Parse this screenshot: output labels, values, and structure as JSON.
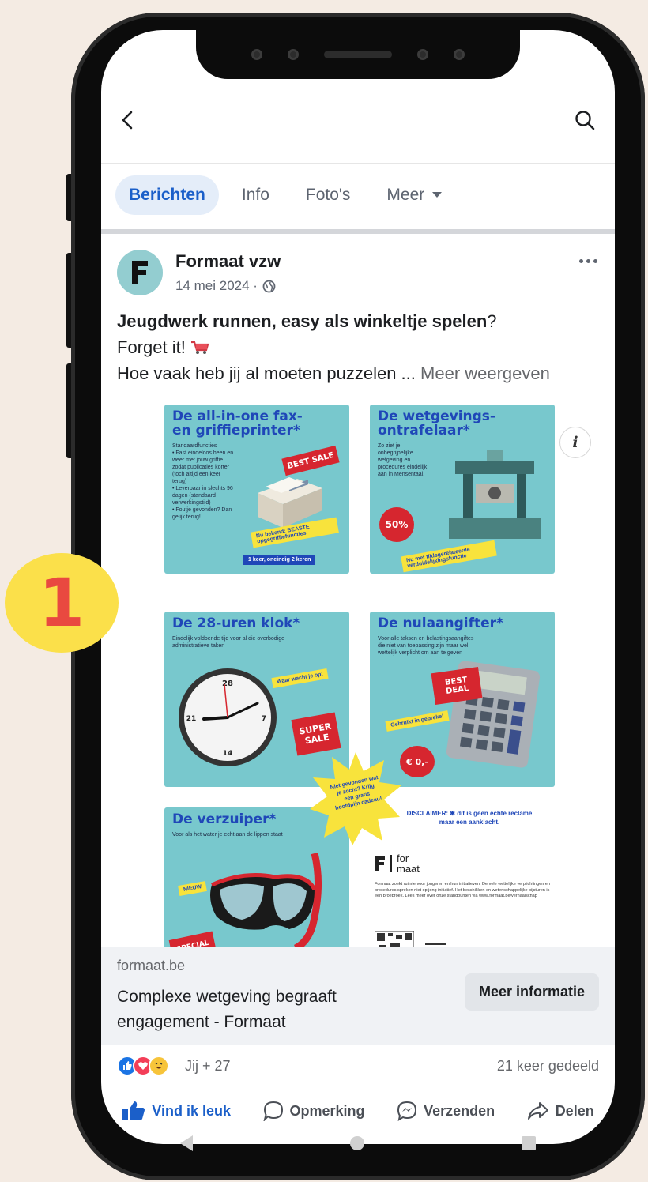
{
  "step_badge": "1",
  "tabs": [
    {
      "label": "Berichten"
    },
    {
      "label": "Info"
    },
    {
      "label": "Foto's"
    },
    {
      "label": "Meer"
    }
  ],
  "post": {
    "author": "Formaat vzw",
    "date": "14 mei 2024 ·",
    "text_line1_bold": "Jeugdwerk runnen, easy als winkeltje spelen",
    "text_line1_end": "?",
    "text_line2": "Forget it!",
    "text_line3": "Hoe vaak heb jij al moeten puzzelen ...",
    "see_more": "Meer weergeven"
  },
  "image": {
    "info_glyph": "i",
    "cards": [
      {
        "title": "De all-in-one fax-\nen griffieprinter*",
        "body": "Standaardfuncties\n• Fast eindeloos heen en weer met jouw griffie zodat publicaties korter (toch altijd een keer terug)\n• Leverbaar in slechts 96 dagen (standaard verwerkingstijd)\n• Foutje gevonden? Dan gelijk terug!",
        "tag1": "BEST SALE",
        "tag2": "Nu bekend: BEASTE opgegriffiefuncties",
        "tag3": "1 keer, oneindig 2 keren"
      },
      {
        "title": "De wetgevings-\nontrafelaar*",
        "body": "Zo ziet je onbegrijpelijke wetgeving en procedures eindelijk aan in Mensentaal.",
        "tag1": "50%",
        "tag2": "Nu met tijdsgerelateerde verduidelijkingsfunctie"
      },
      {
        "title": "De 28-uren klok*",
        "body": "Eindelijk voldoende tijd voor al die overbodige administratieve taken",
        "tag1": "Waar wacht je op!",
        "tag2": "SUPER SALE"
      },
      {
        "title": "De nulaangifter*",
        "body": "Voor alle taksen en belastingsaangiftes die niet van toepassing zijn maar wel wettelijk verplicht om aan te geven",
        "tag1": "BEST DEAL",
        "tag2": "Gebruikt in gebreke!",
        "tag3": "€ 0,-"
      },
      {
        "title": "De verzuiper*",
        "body": "Voor als het water je echt aan de lippen staat",
        "tag1": "NIEUW",
        "tag2": "SPECIAL"
      }
    ],
    "burst_text": "Niet gevonden wat je zocht? Krijg een gratis hoofdpijn cadeau!",
    "disclaimer": "DISCLAIMER: ✱ dit is geen echte reclame maar een aanklacht.",
    "logo_for": "for",
    "logo_maat": "maat",
    "small_text": "Formaat zoekt ruimte voor jongeren en hun initiatieven. De vele wettelijke verplichtingen en procedures spreken niet op jong initiatief. Het beschikken en wetenschappelijke bijsturen is een broebroek. Lees meer over onze standpunten via www.formaat.be/verhaalschap"
  },
  "link_preview": {
    "domain": "formaat.be",
    "title": "Complexe wetgeving begraaft engagement - Formaat",
    "cta": "Meer informatie"
  },
  "reactions": {
    "count": "Jij + 27",
    "shares": "21 keer gedeeld"
  },
  "actions": [
    {
      "label": "Vind ik leuk"
    },
    {
      "label": "Opmerking"
    },
    {
      "label": "Verzenden"
    },
    {
      "label": "Delen"
    }
  ],
  "colors": {
    "page_bg": "#f4ebe3",
    "badge_yellow": "#fbe04a",
    "badge_red": "#e94940",
    "facebook_blue": "#1b5fc9",
    "card_teal": "#78c8cd"
  }
}
